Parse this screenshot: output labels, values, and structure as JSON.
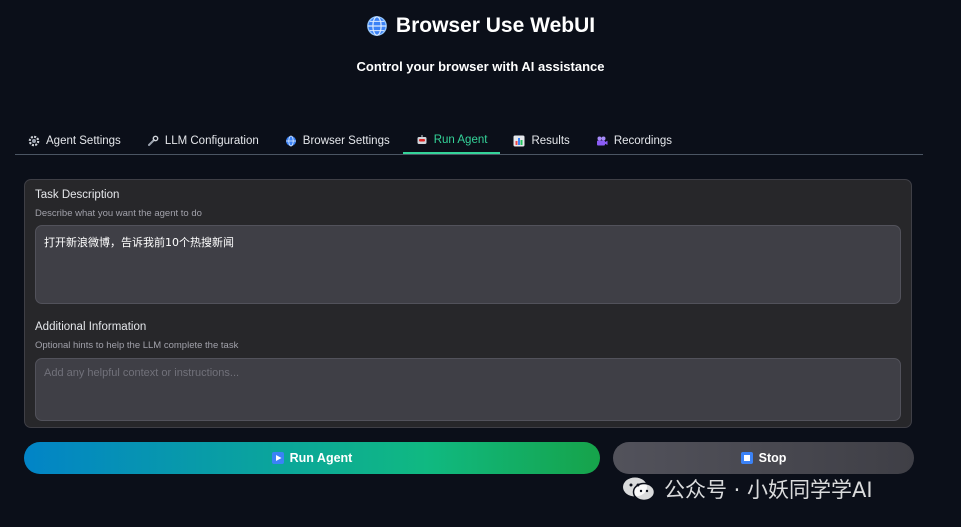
{
  "header": {
    "title": "Browser Use WebUI",
    "subtitle": "Control your browser with AI assistance"
  },
  "tabs": [
    {
      "label": "Agent Settings",
      "icon": "gear-icon"
    },
    {
      "label": "LLM Configuration",
      "icon": "wrench-icon"
    },
    {
      "label": "Browser Settings",
      "icon": "globe-icon"
    },
    {
      "label": "Run Agent",
      "icon": "robot-icon",
      "active": true
    },
    {
      "label": "Results",
      "icon": "bar-chart-icon"
    },
    {
      "label": "Recordings",
      "icon": "movie-camera-icon"
    }
  ],
  "task": {
    "label": "Task Description",
    "hint": "Describe what you want the agent to do",
    "value": "打开新浪微博，告诉我前10个热搜新闻"
  },
  "additional": {
    "label": "Additional Information",
    "hint": "Optional hints to help the LLM complete the task",
    "placeholder": "Add any helpful context or instructions..."
  },
  "buttons": {
    "run_label": "Run Agent",
    "stop_label": "Stop"
  },
  "watermark": {
    "text": "公众号 · 小妖同学学AI"
  },
  "colors": {
    "background": "#0b0f19",
    "accent": "#34d399",
    "run_gradient_start": "#0284c7",
    "run_gradient_end": "#16a34a"
  }
}
